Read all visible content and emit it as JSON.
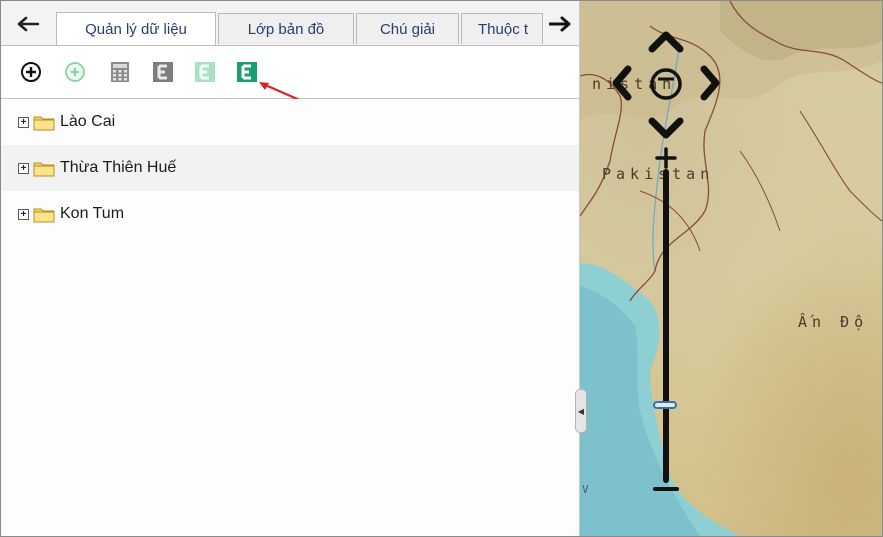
{
  "tabs": [
    {
      "label": "Quản lý dữ liệu",
      "active": true
    },
    {
      "label": "Lớp bản đồ",
      "active": false
    },
    {
      "label": "Chú giải",
      "active": false
    },
    {
      "label": "Thuộc t",
      "active": false
    }
  ],
  "tab_nav": {
    "prev_icon": "arrow-left-icon",
    "next_icon": "arrow-right-icon"
  },
  "toolbar": {
    "tools": [
      {
        "icon": "add-circle-icon",
        "enabled": true
      },
      {
        "icon": "add-circle-icon",
        "enabled": false
      },
      {
        "icon": "calculator-icon",
        "enabled": false
      },
      {
        "icon": "export-e-icon",
        "enabled": false
      },
      {
        "icon": "export-e-icon",
        "enabled": false
      },
      {
        "icon": "export-e-icon",
        "enabled": true,
        "highlighted": true
      }
    ]
  },
  "tree": {
    "items": [
      {
        "label": "Lào Cai"
      },
      {
        "label": "Thừa Thiên Huế"
      },
      {
        "label": "Kon Tum"
      }
    ]
  },
  "map": {
    "labels": {
      "afghanistan_partial": "nistan",
      "pakistan": "Pakistan",
      "india": "Ấn Độ",
      "edge_letter": "V"
    },
    "zoom_level": 0.25
  },
  "colors": {
    "tab_text": "#2a3c6a",
    "accent_green": "#1a9e6e",
    "water": "#8ecfd3",
    "land": "#d6caa0",
    "annotation_arrow": "#e02020"
  }
}
